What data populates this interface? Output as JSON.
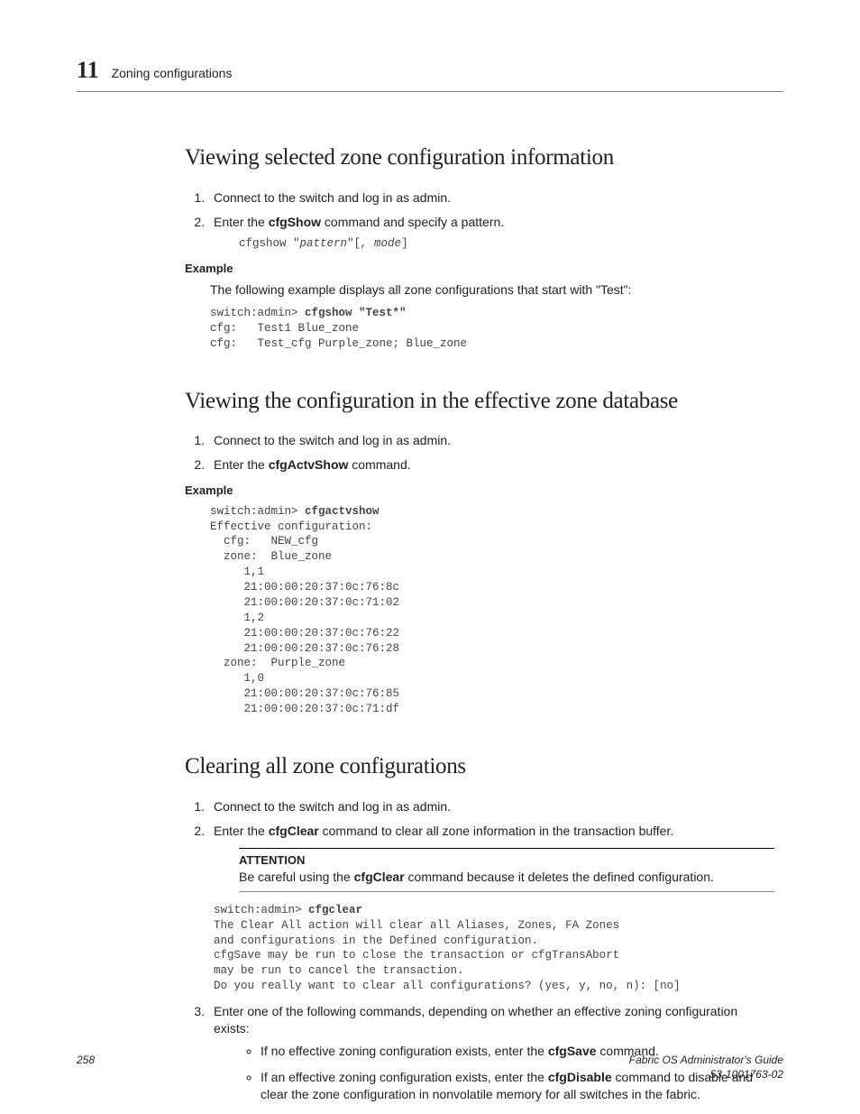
{
  "header": {
    "chapter_number": "11",
    "chapter_title": "Zoning configurations"
  },
  "sections": {
    "s1": {
      "heading": "Viewing selected zone configuration information",
      "step1": "Connect to the switch and log in as admin.",
      "step2_pre": "Enter the ",
      "step2_cmd": "cfgShow",
      "step2_post": " command and specify a pattern.",
      "code1_a": "cfgshow \"",
      "code1_b": "pattern",
      "code1_c": "\"[",
      "code1_d": ", mode",
      "code1_e": "]",
      "example_label": "Example",
      "example_text": "The following example displays all zone configurations that start with \"Test\":",
      "code2_line1a": "switch:admin> ",
      "code2_line1b": "cfgshow \"Test*\"",
      "code2_rest": "cfg:   Test1 Blue_zone\ncfg:   Test_cfg Purple_zone; Blue_zone"
    },
    "s2": {
      "heading": "Viewing the configuration in the effective zone database",
      "step1": "Connect to the switch and log in as admin.",
      "step2_pre": "Enter the ",
      "step2_cmd": "cfgActvShow",
      "step2_post": " command.",
      "example_label": "Example",
      "code_line1a": "switch:admin> ",
      "code_line1b": "cfgactvshow",
      "code_rest": "Effective configuration:\n  cfg:   NEW_cfg\n  zone:  Blue_zone\n     1,1\n     21:00:00:20:37:0c:76:8c\n     21:00:00:20:37:0c:71:02\n     1,2\n     21:00:00:20:37:0c:76:22\n     21:00:00:20:37:0c:76:28\n  zone:  Purple_zone\n     1,0\n     21:00:00:20:37:0c:76:85\n     21:00:00:20:37:0c:71:df"
    },
    "s3": {
      "heading": "Clearing all zone configurations",
      "step1": "Connect to the switch and log in as admin.",
      "step2_pre": "Enter the ",
      "step2_cmd": "cfgClear",
      "step2_post": " command to clear all zone information in the transaction buffer.",
      "attention_label": "ATTENTION",
      "attention_text_a": "Be careful using the ",
      "attention_cmd": "cfgClear",
      "attention_text_b": " command because it deletes the defined configuration.",
      "code_line1a": "switch:admin> ",
      "code_line1b": "cfgclear",
      "code_rest": "The Clear All action will clear all Aliases, Zones, FA Zones\nand configurations in the Defined configuration.\ncfgSave may be run to close the transaction or cfgTransAbort\nmay be run to cancel the transaction.\nDo you really want to clear all configurations? (yes, y, no, n): [no]",
      "step3": "Enter one of the following commands, depending on whether an effective zoning configuration exists:",
      "bullet1_a": "If no effective zoning configuration exists, enter the ",
      "bullet1_cmd": "cfgSave",
      "bullet1_b": " command.",
      "bullet2_a": "If an effective zoning configuration exists, enter the ",
      "bullet2_cmd": "cfgDisable",
      "bullet2_b": " command to disable and clear the zone configuration in nonvolatile memory for all switches in the fabric."
    }
  },
  "footer": {
    "page_number": "258",
    "doc_title": "Fabric OS Administrator's Guide",
    "doc_id": "53-1001763-02"
  }
}
